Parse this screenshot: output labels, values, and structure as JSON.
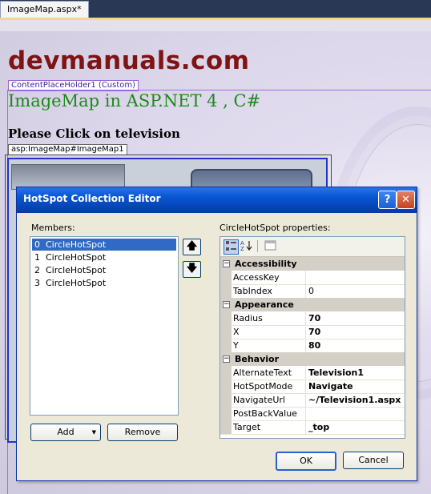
{
  "ide": {
    "tab_label": "ImageMap.aspx*"
  },
  "page": {
    "logo": "devmanuals.com",
    "content_placeholder_tag": "ContentPlaceHolder1 (Custom)",
    "heading": "ImageMap in ASP.NET 4 , C#",
    "subheading": "Please Click on television",
    "imagemap_tag": "asp:ImageMap#ImageMap1"
  },
  "dialog": {
    "title": "HotSpot Collection Editor",
    "help_glyph": "?",
    "close_glyph": "✕",
    "members_label": "Members:",
    "members": [
      {
        "index": "0",
        "name": "CircleHotSpot",
        "selected": true
      },
      {
        "index": "1",
        "name": "CircleHotSpot",
        "selected": false
      },
      {
        "index": "2",
        "name": "CircleHotSpot",
        "selected": false
      },
      {
        "index": "3",
        "name": "CircleHotSpot",
        "selected": false
      }
    ],
    "move_up_glyph": "🡅",
    "move_down_glyph": "🡇",
    "add_label": "Add",
    "add_dropdown_glyph": "▼",
    "remove_label": "Remove",
    "properties_label": "CircleHotSpot properties:",
    "categories": {
      "accessibility": {
        "name": "Accessibility",
        "props": [
          {
            "name": "AccessKey",
            "value": ""
          },
          {
            "name": "TabIndex",
            "value": "0"
          }
        ]
      },
      "appearance": {
        "name": "Appearance",
        "props": [
          {
            "name": "Radius",
            "value": "70"
          },
          {
            "name": "X",
            "value": "70"
          },
          {
            "name": "Y",
            "value": "80"
          }
        ]
      },
      "behavior": {
        "name": "Behavior",
        "props": [
          {
            "name": "AlternateText",
            "value": "Television1"
          },
          {
            "name": "HotSpotMode",
            "value": "Navigate"
          },
          {
            "name": "NavigateUrl",
            "value": "~/Television1.aspx"
          },
          {
            "name": "PostBackValue",
            "value": ""
          },
          {
            "name": "Target",
            "value": "_top"
          }
        ]
      }
    },
    "collapse_glyph": "−",
    "ok_label": "OK",
    "cancel_label": "Cancel"
  }
}
